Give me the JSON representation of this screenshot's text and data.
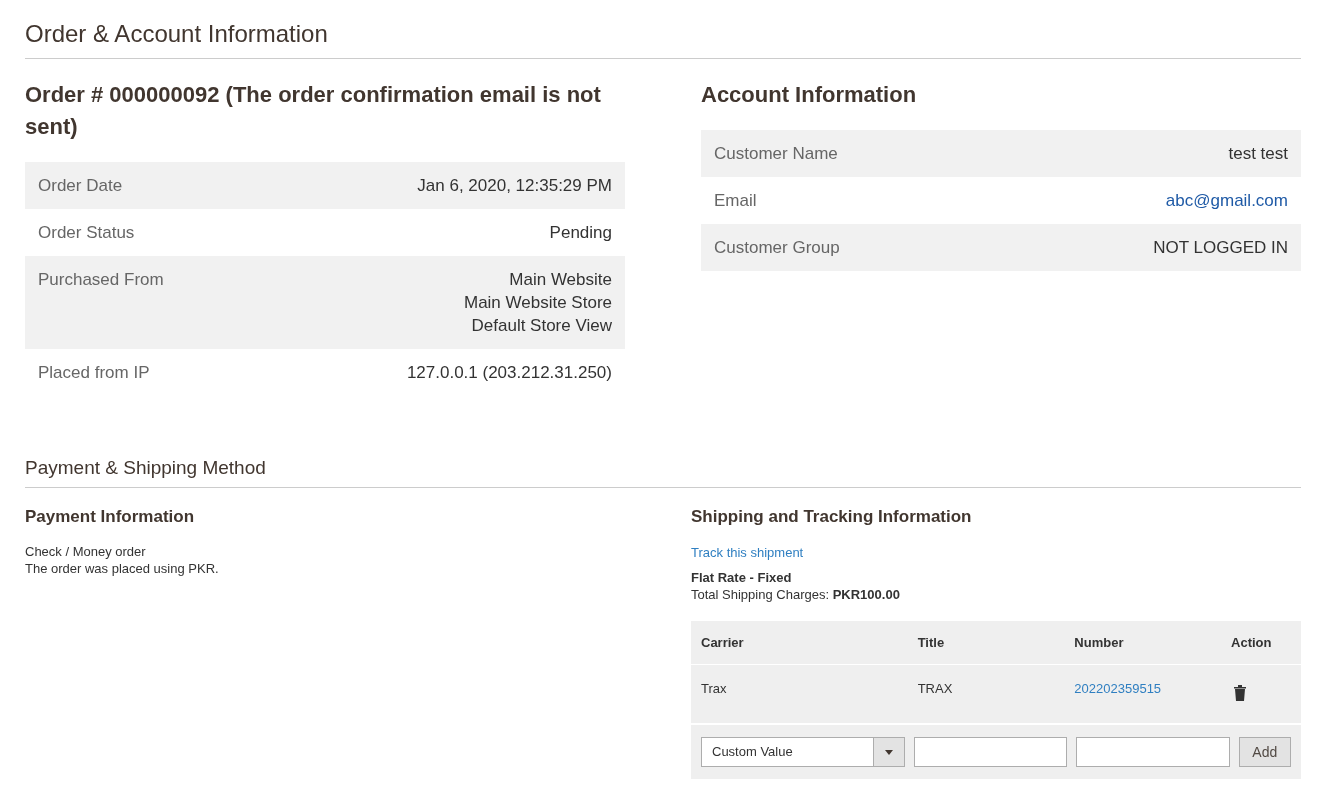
{
  "section_title": "Order & Account Information",
  "order": {
    "heading": "Order # 000000092 (The order confirmation email is not sent)",
    "rows": [
      {
        "label": "Order Date",
        "lines": [
          "Jan 6, 2020, 12:35:29 PM"
        ]
      },
      {
        "label": "Order Status",
        "lines": [
          "Pending"
        ]
      },
      {
        "label": "Purchased From",
        "lines": [
          "Main Website",
          "Main Website Store",
          "Default Store View"
        ]
      },
      {
        "label": "Placed from IP",
        "lines": [
          "127.0.0.1 (203.212.31.250)"
        ]
      }
    ]
  },
  "account": {
    "heading": "Account Information",
    "rows": [
      {
        "label": "Customer Name",
        "value": "test test",
        "kind": "text"
      },
      {
        "label": "Email",
        "value": "abc@gmail.com",
        "kind": "link"
      },
      {
        "label": "Customer Group",
        "value": "NOT LOGGED IN",
        "kind": "text"
      }
    ]
  },
  "payment_shipping_title": "Payment & Shipping Method",
  "payment": {
    "heading": "Payment Information",
    "lines": [
      "Check / Money order",
      "The order was placed using PKR."
    ]
  },
  "shipping": {
    "heading": "Shipping and Tracking Information",
    "track_link": "Track this shipment",
    "method": "Flat Rate - Fixed",
    "charges": "Total Shipping Charges: **PKR100.00**",
    "table": {
      "columns": [
        "Carrier",
        "Title",
        "Number",
        "Action"
      ],
      "rows": [
        {
          "carrier": "Trax",
          "title": "TRAX",
          "number": "202202359515"
        }
      ],
      "new_row": {
        "carrier_select": "Custom Value",
        "button": "Add"
      }
    }
  }
}
